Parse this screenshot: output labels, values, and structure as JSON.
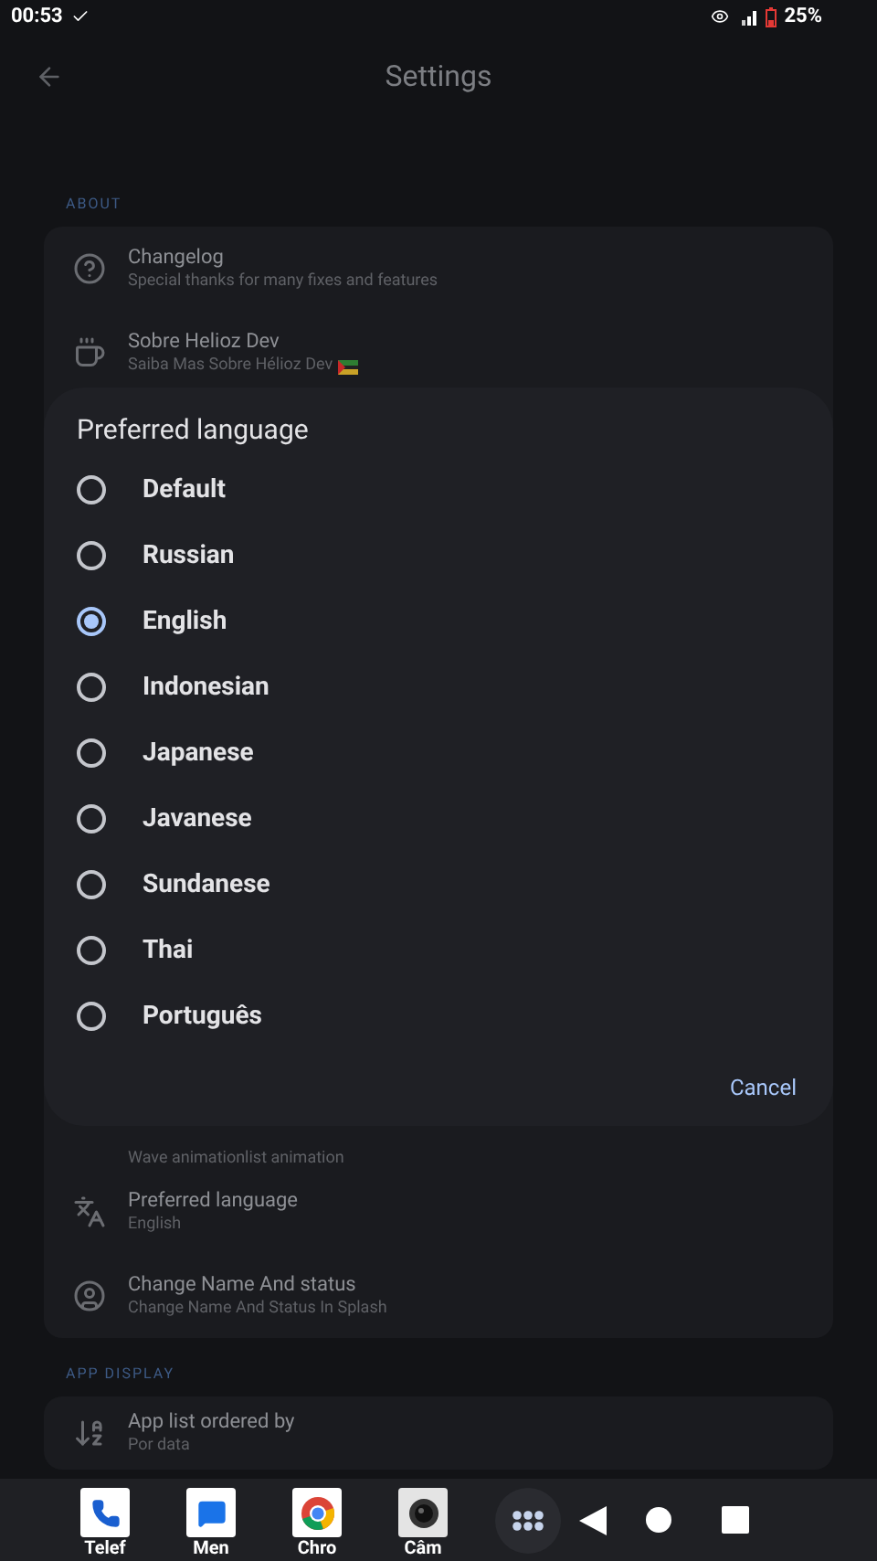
{
  "status_bar": {
    "time": "00:53",
    "battery": "25%"
  },
  "header": {
    "title": "Settings"
  },
  "sections": [
    {
      "label": "ABOUT",
      "rows": [
        {
          "kind": "help",
          "title": "Changelog",
          "subtitle": "Special thanks for many fixes and features"
        },
        {
          "kind": "cup",
          "title": "Sobre Helioz Dev",
          "subtitle": "Saiba Mas Sobre Hélioz Dev",
          "flag": true
        },
        {
          "kind": "hidden",
          "subtitle": "Wave animationlist animation"
        },
        {
          "kind": "translate",
          "title": "Preferred language",
          "subtitle": "English"
        },
        {
          "kind": "user",
          "title": "Change Name And status",
          "subtitle": "Change Name And Status In Splash"
        }
      ]
    },
    {
      "label": "APP DISPLAY",
      "rows": [
        {
          "kind": "sort",
          "title": "App list ordered by",
          "subtitle": "Por data"
        }
      ]
    }
  ],
  "dialog": {
    "title": "Preferred language",
    "options": [
      {
        "label": "Default",
        "selected": false
      },
      {
        "label": "Russian",
        "selected": false
      },
      {
        "label": "English",
        "selected": true
      },
      {
        "label": "Indonesian",
        "selected": false
      },
      {
        "label": "Japanese",
        "selected": false
      },
      {
        "label": "Javanese",
        "selected": false
      },
      {
        "label": "Sundanese",
        "selected": false
      },
      {
        "label": "Thai",
        "selected": false
      },
      {
        "label": "Português",
        "selected": false
      }
    ],
    "cancel": "Cancel"
  },
  "dock": {
    "apps": [
      {
        "kind": "phone",
        "label": "Telef"
      },
      {
        "kind": "messages",
        "label": "Men"
      },
      {
        "kind": "chrome",
        "label": "Chro"
      },
      {
        "kind": "camera",
        "label": "Câm"
      }
    ]
  }
}
